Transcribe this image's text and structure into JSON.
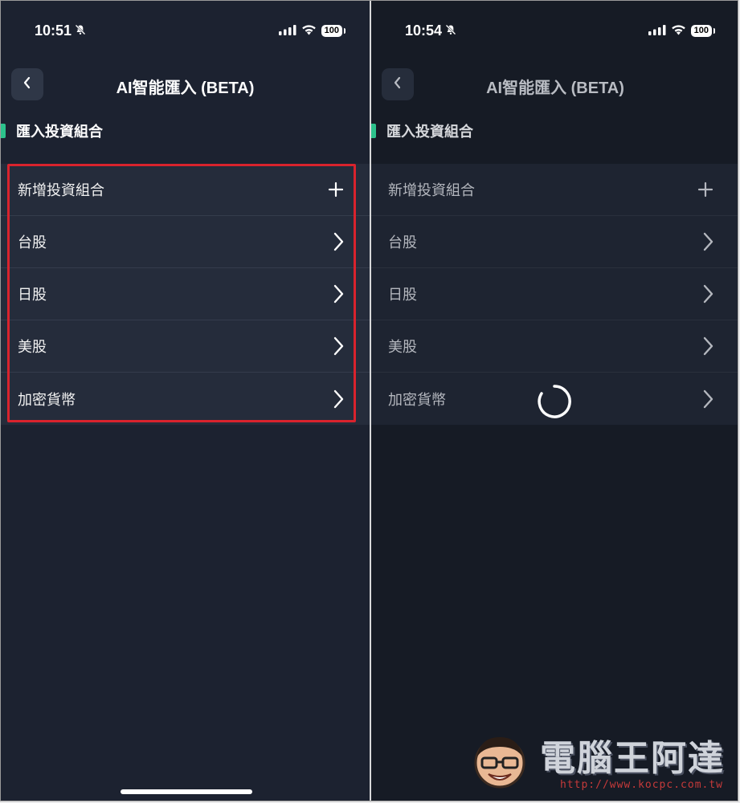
{
  "left_screen": {
    "status": {
      "time": "10:51",
      "battery": "100"
    },
    "nav": {
      "title": "AI智能匯入 (BETA)"
    },
    "section": {
      "title": "匯入投資組合"
    },
    "items": [
      {
        "label": "新增投資組合",
        "icon": "plus-icon"
      },
      {
        "label": "台股",
        "icon": "chevron-right-icon"
      },
      {
        "label": "日股",
        "icon": "chevron-right-icon"
      },
      {
        "label": "美股",
        "icon": "chevron-right-icon"
      },
      {
        "label": "加密貨幣",
        "icon": "chevron-right-icon"
      }
    ]
  },
  "right_screen": {
    "status": {
      "time": "10:54",
      "battery": "100"
    },
    "nav": {
      "title": "AI智能匯入 (BETA)"
    },
    "section": {
      "title": "匯入投資組合"
    },
    "items": [
      {
        "label": "新增投資組合",
        "icon": "plus-icon"
      },
      {
        "label": "台股",
        "icon": "chevron-right-icon"
      },
      {
        "label": "日股",
        "icon": "chevron-right-icon"
      },
      {
        "label": "美股",
        "icon": "chevron-right-icon"
      },
      {
        "label": "加密貨幣",
        "icon": "chevron-right-icon"
      }
    ],
    "loading": true
  },
  "watermark": {
    "title": "電腦王阿達",
    "url": "http://www.kocpc.com.tw"
  },
  "colors": {
    "accent": "#2cc28c",
    "highlight": "#d9232d",
    "background": "#1c2230",
    "list_background": "#252c3b"
  }
}
